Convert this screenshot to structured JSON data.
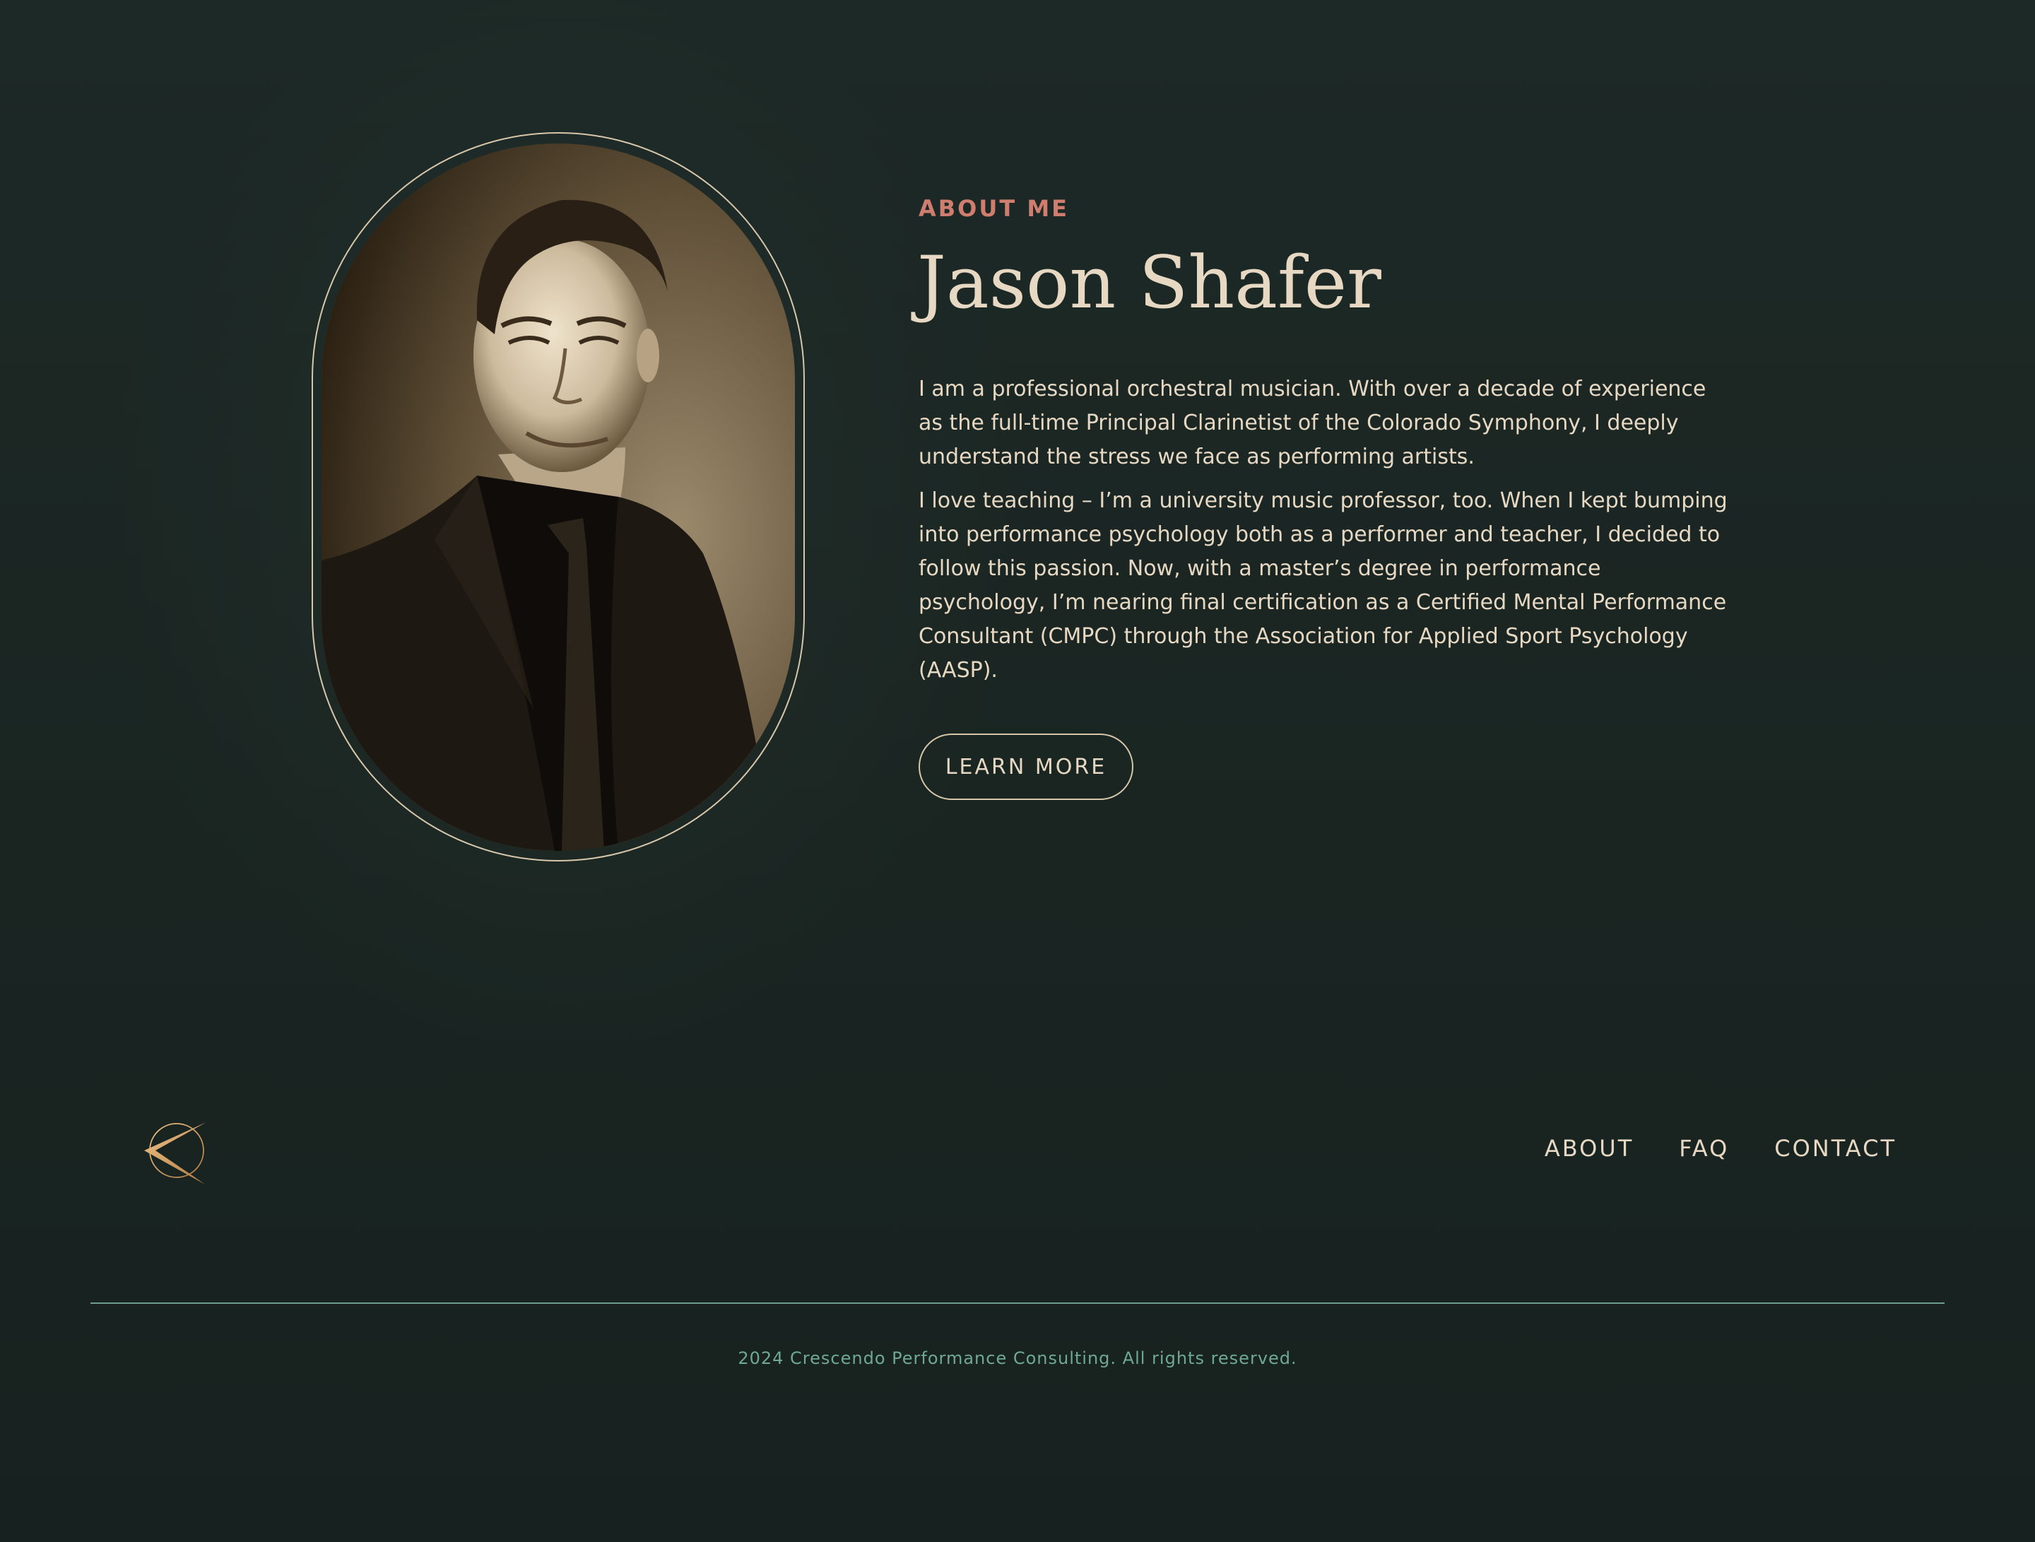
{
  "about": {
    "eyebrow": "ABOUT ME",
    "name": "Jason Shafer",
    "paragraphs": [
      "I am a professional orchestral musician. With over a decade of experience as the full-time Principal Clarinetist of the Colorado Symphony, I deeply understand the stress we face as performing artists.",
      "I love teaching – I’m a university music professor, too. When I kept bumping into performance psychology both as a performer and teacher, I decided to follow this passion. Now, with a master’s degree in performance psychology, I’m nearing final certification as a Certified Mental Performance Consultant (CMPC) through the Association for Applied Sport Psychology (AASP)."
    ],
    "button_label": "LEARN MORE"
  },
  "footer": {
    "logo_icon": "crescendo-chevron-icon",
    "nav": [
      "ABOUT",
      "FAQ",
      "CONTACT"
    ],
    "copyright": "2024 Crescendo Performance Consulting. All rights reserved."
  },
  "colors": {
    "background": "#19231f",
    "text": "#e6d8c2",
    "accent": "#cf7d6e",
    "muted_teal": "#6fa894",
    "logo_gold": "#d9a46a"
  }
}
